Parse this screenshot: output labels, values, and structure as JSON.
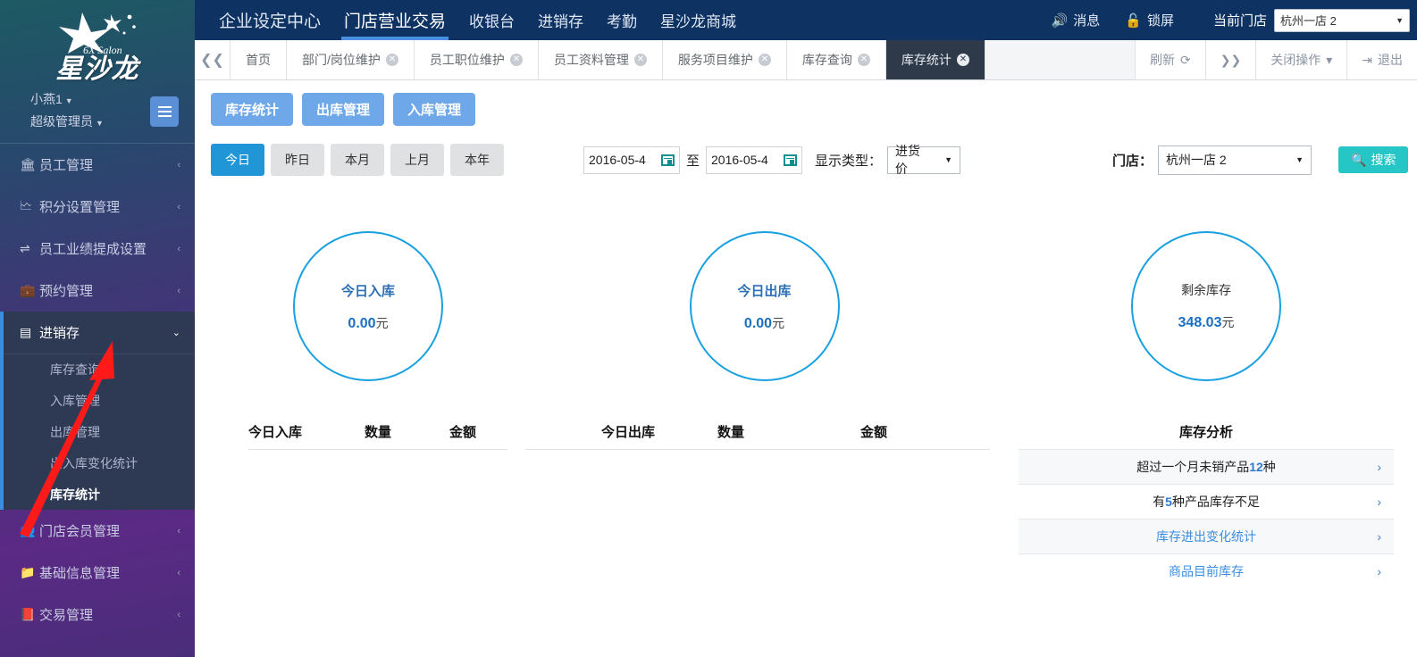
{
  "sidebar": {
    "brand": "星沙龙",
    "brand_sub": "6X Salon",
    "user": "小燕1",
    "role": "超级管理员",
    "menu": [
      {
        "label": "员工管理",
        "icon": "bank-icon",
        "arrow": "‹"
      },
      {
        "label": "积分设置管理",
        "icon": "sitemap-icon",
        "arrow": "‹"
      },
      {
        "label": "员工业绩提成设置",
        "icon": "sliders-icon",
        "arrow": "‹"
      },
      {
        "label": "预约管理",
        "icon": "briefcase-icon",
        "arrow": "‹"
      }
    ],
    "open_menu": {
      "label": "进销存",
      "icon": "card-icon",
      "arrow": "⌄"
    },
    "submenu": [
      {
        "label": "库存查询",
        "active": false
      },
      {
        "label": "入库管理",
        "active": false
      },
      {
        "label": "出库管理",
        "active": false
      },
      {
        "label": "出入库变化统计",
        "active": false
      },
      {
        "label": "库存统计",
        "active": true
      }
    ],
    "menu_bottom": [
      {
        "label": "门店会员管理",
        "icon": "users-icon",
        "arrow": "‹"
      },
      {
        "label": "基础信息管理",
        "icon": "folder-icon",
        "arrow": "‹"
      },
      {
        "label": "交易管理",
        "icon": "book-icon",
        "arrow": "‹"
      }
    ]
  },
  "topbar": {
    "nav": [
      {
        "label": "企业设定中心",
        "active": false,
        "size": "large"
      },
      {
        "label": "门店营业交易",
        "active": true,
        "size": "large"
      },
      {
        "label": "收银台",
        "active": false,
        "size": "small"
      },
      {
        "label": "进销存",
        "active": false,
        "size": "small"
      },
      {
        "label": "考勤",
        "active": false,
        "size": "small"
      },
      {
        "label": "星沙龙商城",
        "active": false,
        "size": "small"
      }
    ],
    "messages_label": "消息",
    "lock_label": "锁屏",
    "current_store_label": "当前门店",
    "current_store_value": "杭州一店 2"
  },
  "tabbar": {
    "tabs": [
      {
        "label": "首页",
        "closable": false,
        "active": false
      },
      {
        "label": "部门/岗位维护",
        "closable": true,
        "active": false
      },
      {
        "label": "员工职位维护",
        "closable": true,
        "active": false
      },
      {
        "label": "员工资料管理",
        "closable": true,
        "active": false
      },
      {
        "label": "服务项目维护",
        "closable": true,
        "active": false
      },
      {
        "label": "库存查询",
        "closable": true,
        "active": false
      },
      {
        "label": "库存统计",
        "closable": true,
        "active": true
      }
    ],
    "refresh_label": "刷新",
    "close_ops_label": "关闭操作",
    "exit_label": "退出"
  },
  "toolbar": {
    "buttons": [
      "库存统计",
      "出库管理",
      "入库管理"
    ]
  },
  "filters": {
    "ranges": [
      {
        "label": "今日",
        "active": true
      },
      {
        "label": "昨日",
        "active": false
      },
      {
        "label": "本月",
        "active": false
      },
      {
        "label": "上月",
        "active": false
      },
      {
        "label": "本年",
        "active": false
      }
    ],
    "date_from": "2016-05-4",
    "date_to": "2016-05-4",
    "date_sep": "至",
    "display_type_label": "显示类型：",
    "display_type_value": "进货价",
    "store_label": "门店：",
    "store_value": "杭州一店 2",
    "search_label": "搜索"
  },
  "chart_data": {
    "type": "table",
    "circles": [
      {
        "title": "今日入库",
        "value": "0.00",
        "unit": "元",
        "numeric": 0.0,
        "style": "bold"
      },
      {
        "title": "今日出库",
        "value": "0.00",
        "unit": "元",
        "numeric": 0.0,
        "style": "bold"
      },
      {
        "title": "剩余库存",
        "value": "348.03",
        "unit": "元",
        "numeric": 348.03,
        "style": "plain"
      }
    ],
    "tables": [
      {
        "headers": [
          "今日入库",
          "数量",
          "金额"
        ],
        "rows": []
      },
      {
        "headers": [
          "今日出库",
          "数量",
          "金额"
        ],
        "rows": []
      }
    ]
  },
  "analysis": {
    "title": "库存分析",
    "rows": [
      {
        "pre": "超过一个月未销产品",
        "num": "12",
        "post": " 种",
        "chev": "›",
        "shade": true,
        "link": false
      },
      {
        "pre": "有",
        "num": "5",
        "post": " 种产品库存不足",
        "chev": "›",
        "shade": false,
        "link": false
      },
      {
        "pre": "库存进出变化统计",
        "num": "",
        "post": "",
        "chev": "›",
        "shade": true,
        "link": true
      },
      {
        "pre": "商品目前库存",
        "num": "",
        "post": "",
        "chev": "›",
        "shade": false,
        "link": true
      }
    ]
  }
}
